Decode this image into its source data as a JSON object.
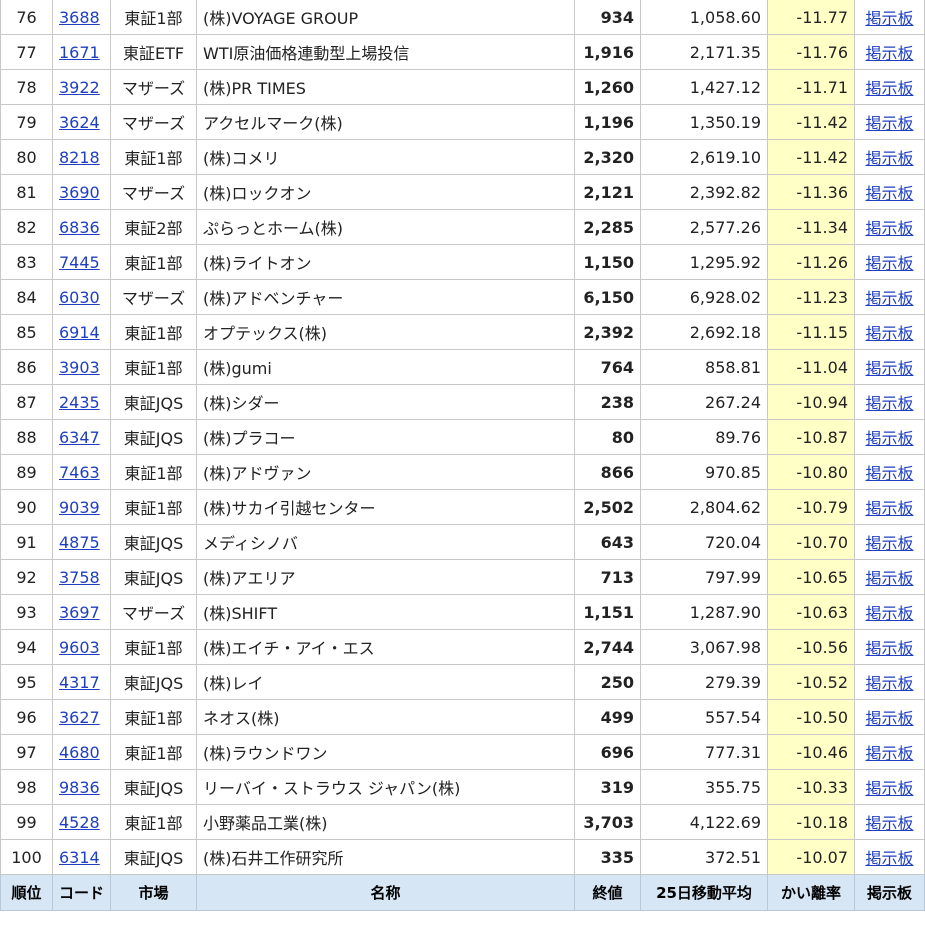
{
  "colors": {
    "link": "#1f3fc0",
    "deviation_bg": "#ffffc6",
    "header_bg": "#d6e6f5",
    "border": "#c8c8c8"
  },
  "table": {
    "headers": {
      "rank": "順位",
      "code": "コード",
      "market": "市場",
      "name": "名称",
      "price": "終値",
      "ma25": "25日移動平均",
      "deviation": "かい離率",
      "board": "掲示板"
    },
    "rows": [
      {
        "rank": "76",
        "code": "3688",
        "market": "東証1部",
        "name": "(株)VOYAGE GROUP",
        "price": "934",
        "ma25": "1,058.60",
        "deviation": "-11.77",
        "board": "掲示板"
      },
      {
        "rank": "77",
        "code": "1671",
        "market": "東証ETF",
        "name": "WTI原油価格連動型上場投信",
        "price": "1,916",
        "ma25": "2,171.35",
        "deviation": "-11.76",
        "board": "掲示板"
      },
      {
        "rank": "78",
        "code": "3922",
        "market": "マザーズ",
        "name": "(株)PR TIMES",
        "price": "1,260",
        "ma25": "1,427.12",
        "deviation": "-11.71",
        "board": "掲示板"
      },
      {
        "rank": "79",
        "code": "3624",
        "market": "マザーズ",
        "name": "アクセルマーク(株)",
        "price": "1,196",
        "ma25": "1,350.19",
        "deviation": "-11.42",
        "board": "掲示板"
      },
      {
        "rank": "80",
        "code": "8218",
        "market": "東証1部",
        "name": "(株)コメリ",
        "price": "2,320",
        "ma25": "2,619.10",
        "deviation": "-11.42",
        "board": "掲示板"
      },
      {
        "rank": "81",
        "code": "3690",
        "market": "マザーズ",
        "name": "(株)ロックオン",
        "price": "2,121",
        "ma25": "2,392.82",
        "deviation": "-11.36",
        "board": "掲示板"
      },
      {
        "rank": "82",
        "code": "6836",
        "market": "東証2部",
        "name": "ぷらっとホーム(株)",
        "price": "2,285",
        "ma25": "2,577.26",
        "deviation": "-11.34",
        "board": "掲示板"
      },
      {
        "rank": "83",
        "code": "7445",
        "market": "東証1部",
        "name": "(株)ライトオン",
        "price": "1,150",
        "ma25": "1,295.92",
        "deviation": "-11.26",
        "board": "掲示板"
      },
      {
        "rank": "84",
        "code": "6030",
        "market": "マザーズ",
        "name": "(株)アドベンチャー",
        "price": "6,150",
        "ma25": "6,928.02",
        "deviation": "-11.23",
        "board": "掲示板"
      },
      {
        "rank": "85",
        "code": "6914",
        "market": "東証1部",
        "name": "オプテックス(株)",
        "price": "2,392",
        "ma25": "2,692.18",
        "deviation": "-11.15",
        "board": "掲示板"
      },
      {
        "rank": "86",
        "code": "3903",
        "market": "東証1部",
        "name": "(株)gumi",
        "price": "764",
        "ma25": "858.81",
        "deviation": "-11.04",
        "board": "掲示板"
      },
      {
        "rank": "87",
        "code": "2435",
        "market": "東証JQS",
        "name": "(株)シダー",
        "price": "238",
        "ma25": "267.24",
        "deviation": "-10.94",
        "board": "掲示板"
      },
      {
        "rank": "88",
        "code": "6347",
        "market": "東証JQS",
        "name": "(株)プラコー",
        "price": "80",
        "ma25": "89.76",
        "deviation": "-10.87",
        "board": "掲示板"
      },
      {
        "rank": "89",
        "code": "7463",
        "market": "東証1部",
        "name": "(株)アドヴァン",
        "price": "866",
        "ma25": "970.85",
        "deviation": "-10.80",
        "board": "掲示板"
      },
      {
        "rank": "90",
        "code": "9039",
        "market": "東証1部",
        "name": "(株)サカイ引越センター",
        "price": "2,502",
        "ma25": "2,804.62",
        "deviation": "-10.79",
        "board": "掲示板"
      },
      {
        "rank": "91",
        "code": "4875",
        "market": "東証JQS",
        "name": "メディシノバ",
        "price": "643",
        "ma25": "720.04",
        "deviation": "-10.70",
        "board": "掲示板"
      },
      {
        "rank": "92",
        "code": "3758",
        "market": "東証JQS",
        "name": "(株)アエリア",
        "price": "713",
        "ma25": "797.99",
        "deviation": "-10.65",
        "board": "掲示板"
      },
      {
        "rank": "93",
        "code": "3697",
        "market": "マザーズ",
        "name": "(株)SHIFT",
        "price": "1,151",
        "ma25": "1,287.90",
        "deviation": "-10.63",
        "board": "掲示板"
      },
      {
        "rank": "94",
        "code": "9603",
        "market": "東証1部",
        "name": "(株)エイチ・アイ・エス",
        "price": "2,744",
        "ma25": "3,067.98",
        "deviation": "-10.56",
        "board": "掲示板"
      },
      {
        "rank": "95",
        "code": "4317",
        "market": "東証JQS",
        "name": "(株)レイ",
        "price": "250",
        "ma25": "279.39",
        "deviation": "-10.52",
        "board": "掲示板"
      },
      {
        "rank": "96",
        "code": "3627",
        "market": "東証1部",
        "name": "ネオス(株)",
        "price": "499",
        "ma25": "557.54",
        "deviation": "-10.50",
        "board": "掲示板"
      },
      {
        "rank": "97",
        "code": "4680",
        "market": "東証1部",
        "name": "(株)ラウンドワン",
        "price": "696",
        "ma25": "777.31",
        "deviation": "-10.46",
        "board": "掲示板"
      },
      {
        "rank": "98",
        "code": "9836",
        "market": "東証JQS",
        "name": "リーバイ・ストラウス ジャパン(株)",
        "price": "319",
        "ma25": "355.75",
        "deviation": "-10.33",
        "board": "掲示板"
      },
      {
        "rank": "99",
        "code": "4528",
        "market": "東証1部",
        "name": "小野薬品工業(株)",
        "price": "3,703",
        "ma25": "4,122.69",
        "deviation": "-10.18",
        "board": "掲示板"
      },
      {
        "rank": "100",
        "code": "6314",
        "market": "東証JQS",
        "name": "(株)石井工作研究所",
        "price": "335",
        "ma25": "372.51",
        "deviation": "-10.07",
        "board": "掲示板"
      }
    ]
  }
}
